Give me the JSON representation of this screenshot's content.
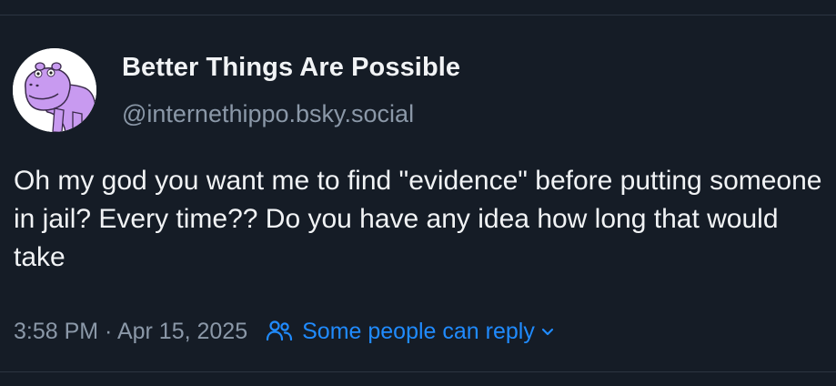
{
  "post": {
    "author": {
      "display_name": "Better Things Are Possible",
      "handle": "@internethippo.bsky.social",
      "avatar_icon": "purple-hippo-avatar"
    },
    "text": "Oh my god you want me to find \"evidence\" before putting someone in jail? Every time?? Do you have any idea how long that would take",
    "timestamp": "3:58 PM · Apr 15, 2025",
    "reply_setting": {
      "label": "Some people can reply",
      "icon": "people-icon",
      "chevron_icon": "chevron-down-icon"
    }
  },
  "colors": {
    "background": "#151c26",
    "text": "#f1f3f5",
    "muted": "#8b98a8",
    "accent": "#208bfe",
    "divider": "#2c3541",
    "avatar_purple": "#c89af0"
  }
}
